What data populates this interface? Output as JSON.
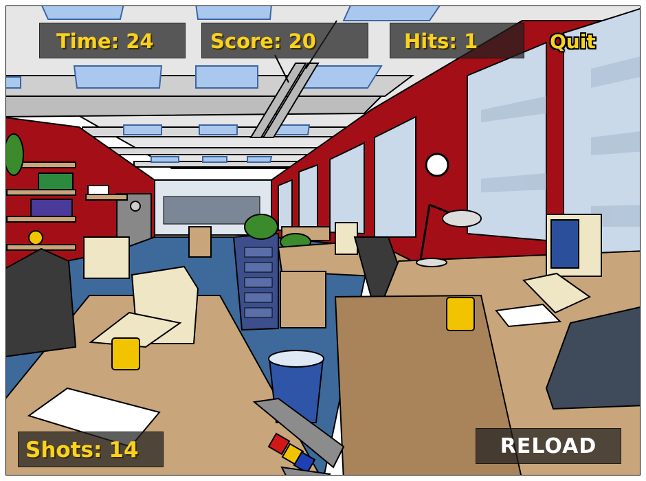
{
  "hud": {
    "time_label": "Time:",
    "time_value": "24",
    "score_label": "Score:",
    "score_value": "20",
    "hits_label": "Hits:",
    "hits_value": "1",
    "shots_label": "Shots:",
    "shots_value": "14"
  },
  "buttons": {
    "quit": "Quit",
    "reload": "RELOAD"
  },
  "colors": {
    "hud_text": "#f8d21f",
    "wall_red": "#a40f17",
    "floor_blue": "#3d6a9b",
    "desk": "#c8a57a"
  }
}
